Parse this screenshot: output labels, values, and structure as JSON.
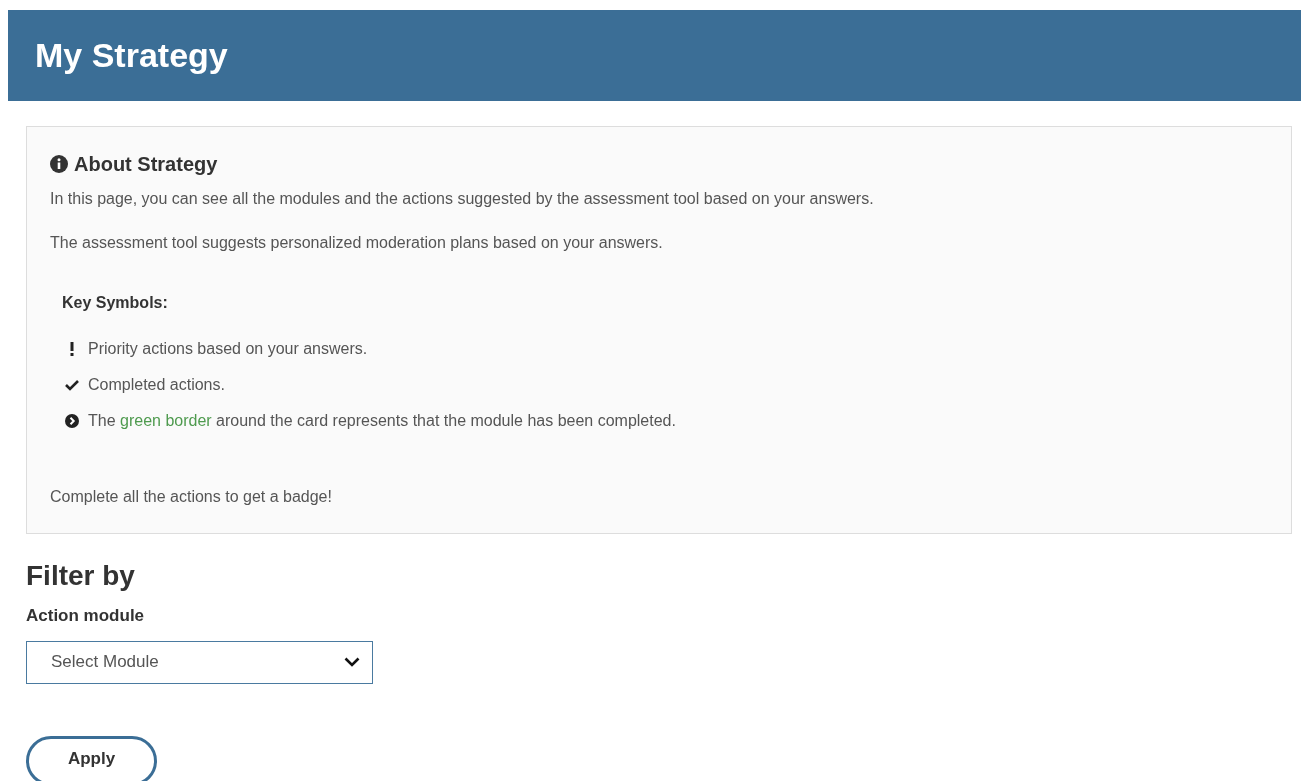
{
  "header": {
    "title": "My Strategy"
  },
  "about": {
    "title": "About Strategy",
    "paragraphs": [
      "In this page, you can see all the modules and the actions suggested by the assessment tool based on your answers.",
      "The assessment tool suggests personalized moderation plans based on your answers."
    ],
    "key_title": "Key Symbols:",
    "symbols": [
      {
        "kind": "priority",
        "parts": [
          {
            "text": "Priority actions based on your answers.",
            "highlighted": false
          }
        ]
      },
      {
        "kind": "completed",
        "parts": [
          {
            "text": "Completed actions.",
            "highlighted": false
          }
        ]
      },
      {
        "kind": "module",
        "parts": [
          {
            "text": "The ",
            "highlighted": false
          },
          {
            "text": "green border",
            "highlighted": true
          },
          {
            "text": " around the card represents that the module has been completed.",
            "highlighted": false
          }
        ]
      }
    ],
    "footer": "Complete all the actions to get a badge!"
  },
  "filter": {
    "title": "Filter by",
    "label": "Action module",
    "select": {
      "placeholder": "Select Module"
    },
    "apply": "Apply"
  }
}
